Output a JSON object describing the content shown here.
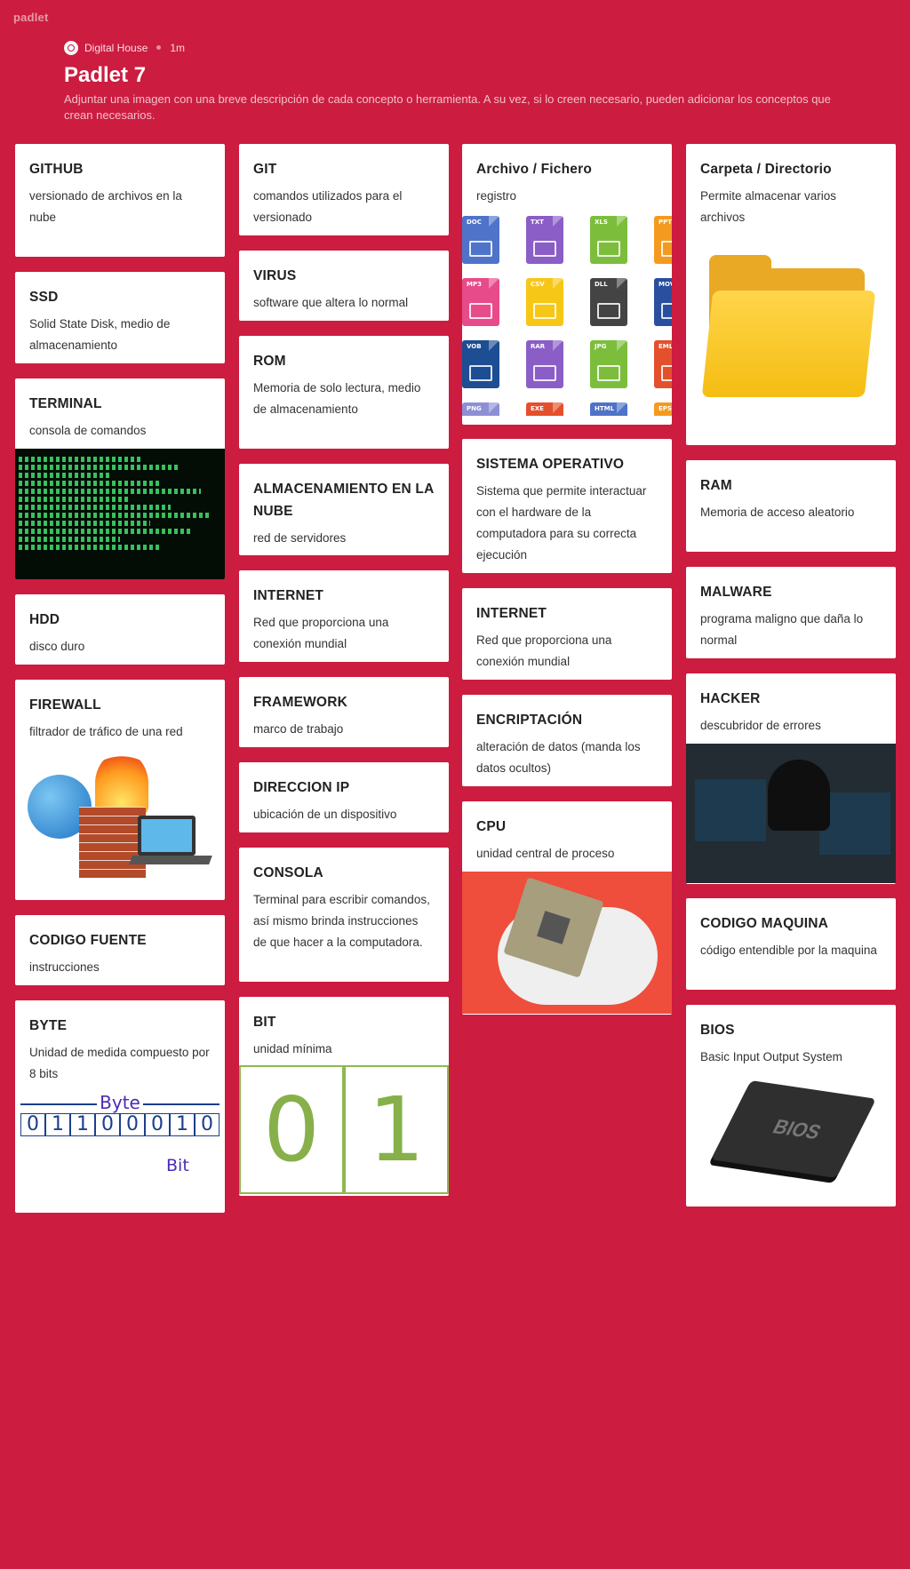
{
  "app": {
    "logo": "padlet"
  },
  "header": {
    "author": "Digital House",
    "age": "1m",
    "title": "Padlet 7",
    "description": "Adjuntar una imagen con una breve descripción de cada concepto o herramienta. A su vez, si lo creen necesario, pueden adicionar los conceptos que crean necesarios."
  },
  "cards": {
    "github": {
      "title": "GITHUB",
      "body": "versionado de archivos en la nube"
    },
    "ssd": {
      "title": "SSD",
      "body": "Solid State Disk, medio de almacenamiento"
    },
    "terminal": {
      "title": "TERMINAL",
      "body": "consola de comandos"
    },
    "hdd": {
      "title": "HDD",
      "body": "disco duro"
    },
    "firewall": {
      "title": "FIREWALL",
      "body": "filtrador de tráfico de una red"
    },
    "codigo_fuente": {
      "title": "CODIGO FUENTE",
      "body": "instrucciones"
    },
    "byte": {
      "title": "BYTE",
      "body": "Unidad de medida compuesto por 8 bits",
      "image_label": "Byte",
      "image_bits": [
        "0",
        "1",
        "1",
        "0",
        "0",
        "0",
        "1",
        "0"
      ],
      "image_bit_label": "Bit"
    },
    "git": {
      "title": "GIT",
      "body": "comandos utilizados para el versionado"
    },
    "virus": {
      "title": "VIRUS",
      "body": "software que altera lo normal"
    },
    "rom": {
      "title": "ROM",
      "body": "Memoria de solo lectura, medio de almacenamiento"
    },
    "nube": {
      "title": "ALMACENAMIENTO EN LA NUBE",
      "body": "red de servidores"
    },
    "internet1": {
      "title": "INTERNET",
      "body": "Red que proporciona una conexión mundial"
    },
    "framework": {
      "title": "FRAMEWORK",
      "body": "marco de trabajo"
    },
    "ip": {
      "title": "DIRECCION IP",
      "body": "ubicación de un dispositivo"
    },
    "consola": {
      "title": "CONSOLA",
      "body": "Terminal para escribir comandos, así mismo brinda instrucciones de que hacer a la computadora."
    },
    "bit": {
      "title": "BIT",
      "body": "unidad mínima",
      "image_digits": [
        "0",
        "1"
      ]
    },
    "archivo": {
      "title": "Archivo / Fichero",
      "body": "registro",
      "files": [
        {
          "ext": "DOC",
          "color": "#4e73c9"
        },
        {
          "ext": "TXT",
          "color": "#8b5dc7"
        },
        {
          "ext": "XLS",
          "color": "#7cbe3c"
        },
        {
          "ext": "PPT",
          "color": "#f49a1e"
        },
        {
          "ext": "MP3",
          "color": "#e84b8a"
        },
        {
          "ext": "CSV",
          "color": "#f7c718"
        },
        {
          "ext": "DLL",
          "color": "#444444"
        },
        {
          "ext": "MOV",
          "color": "#2a4f9e"
        },
        {
          "ext": "VOB",
          "color": "#1d4d93"
        },
        {
          "ext": "RAR",
          "color": "#8b5dc7"
        },
        {
          "ext": "JPG",
          "color": "#7cbe3c"
        },
        {
          "ext": "EML",
          "color": "#e4502c"
        },
        {
          "ext": "PNG",
          "color": "#8d8fd6"
        },
        {
          "ext": "EXE",
          "color": "#e4502c"
        },
        {
          "ext": "HTML",
          "color": "#4e73c9"
        },
        {
          "ext": "EPS",
          "color": "#f49a1e"
        }
      ]
    },
    "so": {
      "title": "SISTEMA OPERATIVO",
      "body": "Sistema que permite interactuar con el hardware de la computadora para su correcta ejecución"
    },
    "internet2": {
      "title": "INTERNET",
      "body": "Red que proporciona una conexión mundial"
    },
    "encriptacion": {
      "title": "ENCRIPTACIÓN",
      "body": "alteración de datos (manda los datos ocultos)"
    },
    "cpu": {
      "title": "CPU",
      "body": "unidad central de proceso"
    },
    "carpeta": {
      "title": "Carpeta / Directorio",
      "body": "Permite almacenar varios archivos"
    },
    "ram": {
      "title": "RAM",
      "body": "Memoria de acceso aleatorio"
    },
    "malware": {
      "title": "MALWARE",
      "body": "programa maligno que daña lo normal"
    },
    "hacker": {
      "title": "HACKER",
      "body": "descubridor de errores"
    },
    "codigo_maquina": {
      "title": "CODIGO MAQUINA",
      "body": "código entendible por la maquina"
    },
    "bios": {
      "title": "BIOS",
      "body": "Basic Input Output System",
      "image_label": "BIOS"
    }
  }
}
